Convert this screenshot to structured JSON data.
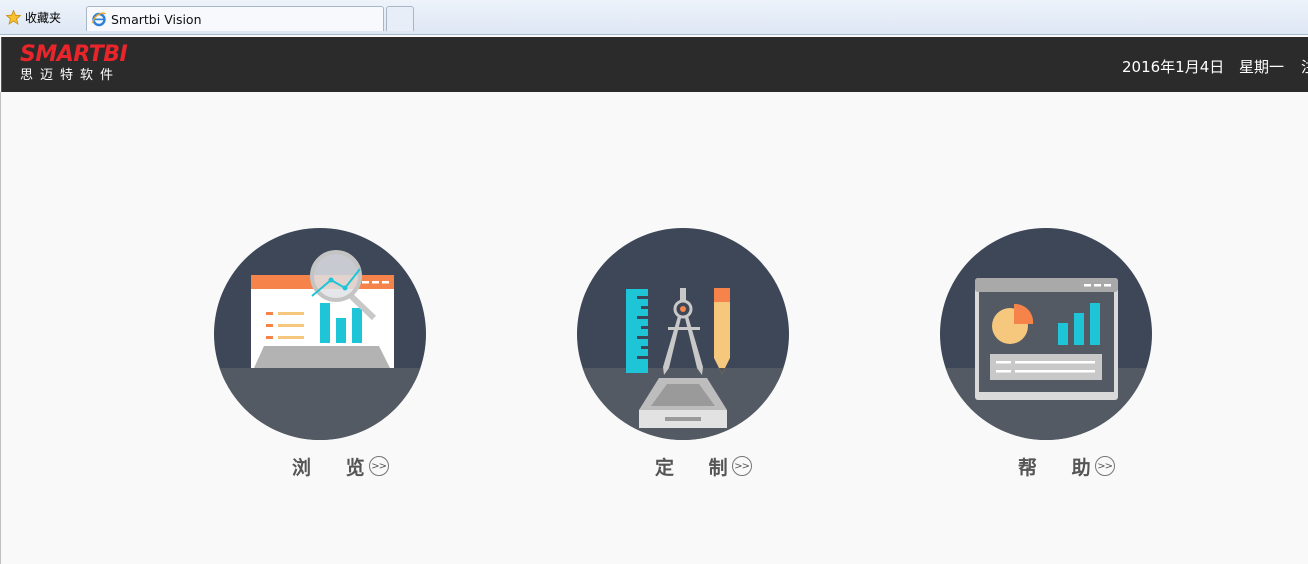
{
  "browser": {
    "favorites_label": "收藏夹",
    "tab_title": "Smartbi Vision"
  },
  "header": {
    "brand_en": "SMARTBI",
    "brand_cn": "思迈特软件",
    "date": "2016年1月4日",
    "weekday": "星期一",
    "cut_text": "注"
  },
  "cards": [
    {
      "label": "浏 览",
      "arrow": ">>",
      "icon": "browse-icon"
    },
    {
      "label": "定 制",
      "arrow": ">>",
      "icon": "customize-icon"
    },
    {
      "label": "帮 助",
      "arrow": ">>",
      "icon": "help-icon"
    }
  ],
  "colors": {
    "header_bg": "#2b2b2b",
    "brand_red": "#e8252b",
    "circle_dark": "#3d4757",
    "circle_floor": "#535a63",
    "accent_cyan": "#1ec5d6",
    "accent_orange": "#f5834a"
  }
}
